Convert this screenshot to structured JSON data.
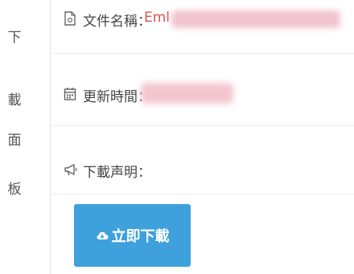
{
  "side_label": [
    "下",
    "載",
    "面",
    "板"
  ],
  "rows": {
    "file_name": {
      "label": "文件名稱：",
      "value_prefix": "Eml",
      "icon": "file-icon"
    },
    "update_time": {
      "label": "更新時間：",
      "icon": "calendar-icon"
    },
    "disclaimer": {
      "label": "下載声明：",
      "icon": "megaphone-icon"
    }
  },
  "download_button": {
    "label": "立即下載",
    "icon": "cloud-download-icon"
  },
  "colors": {
    "accent": "#3ea1db",
    "value_red": "#d9534f",
    "blur_pink": "#f3c6ce"
  }
}
